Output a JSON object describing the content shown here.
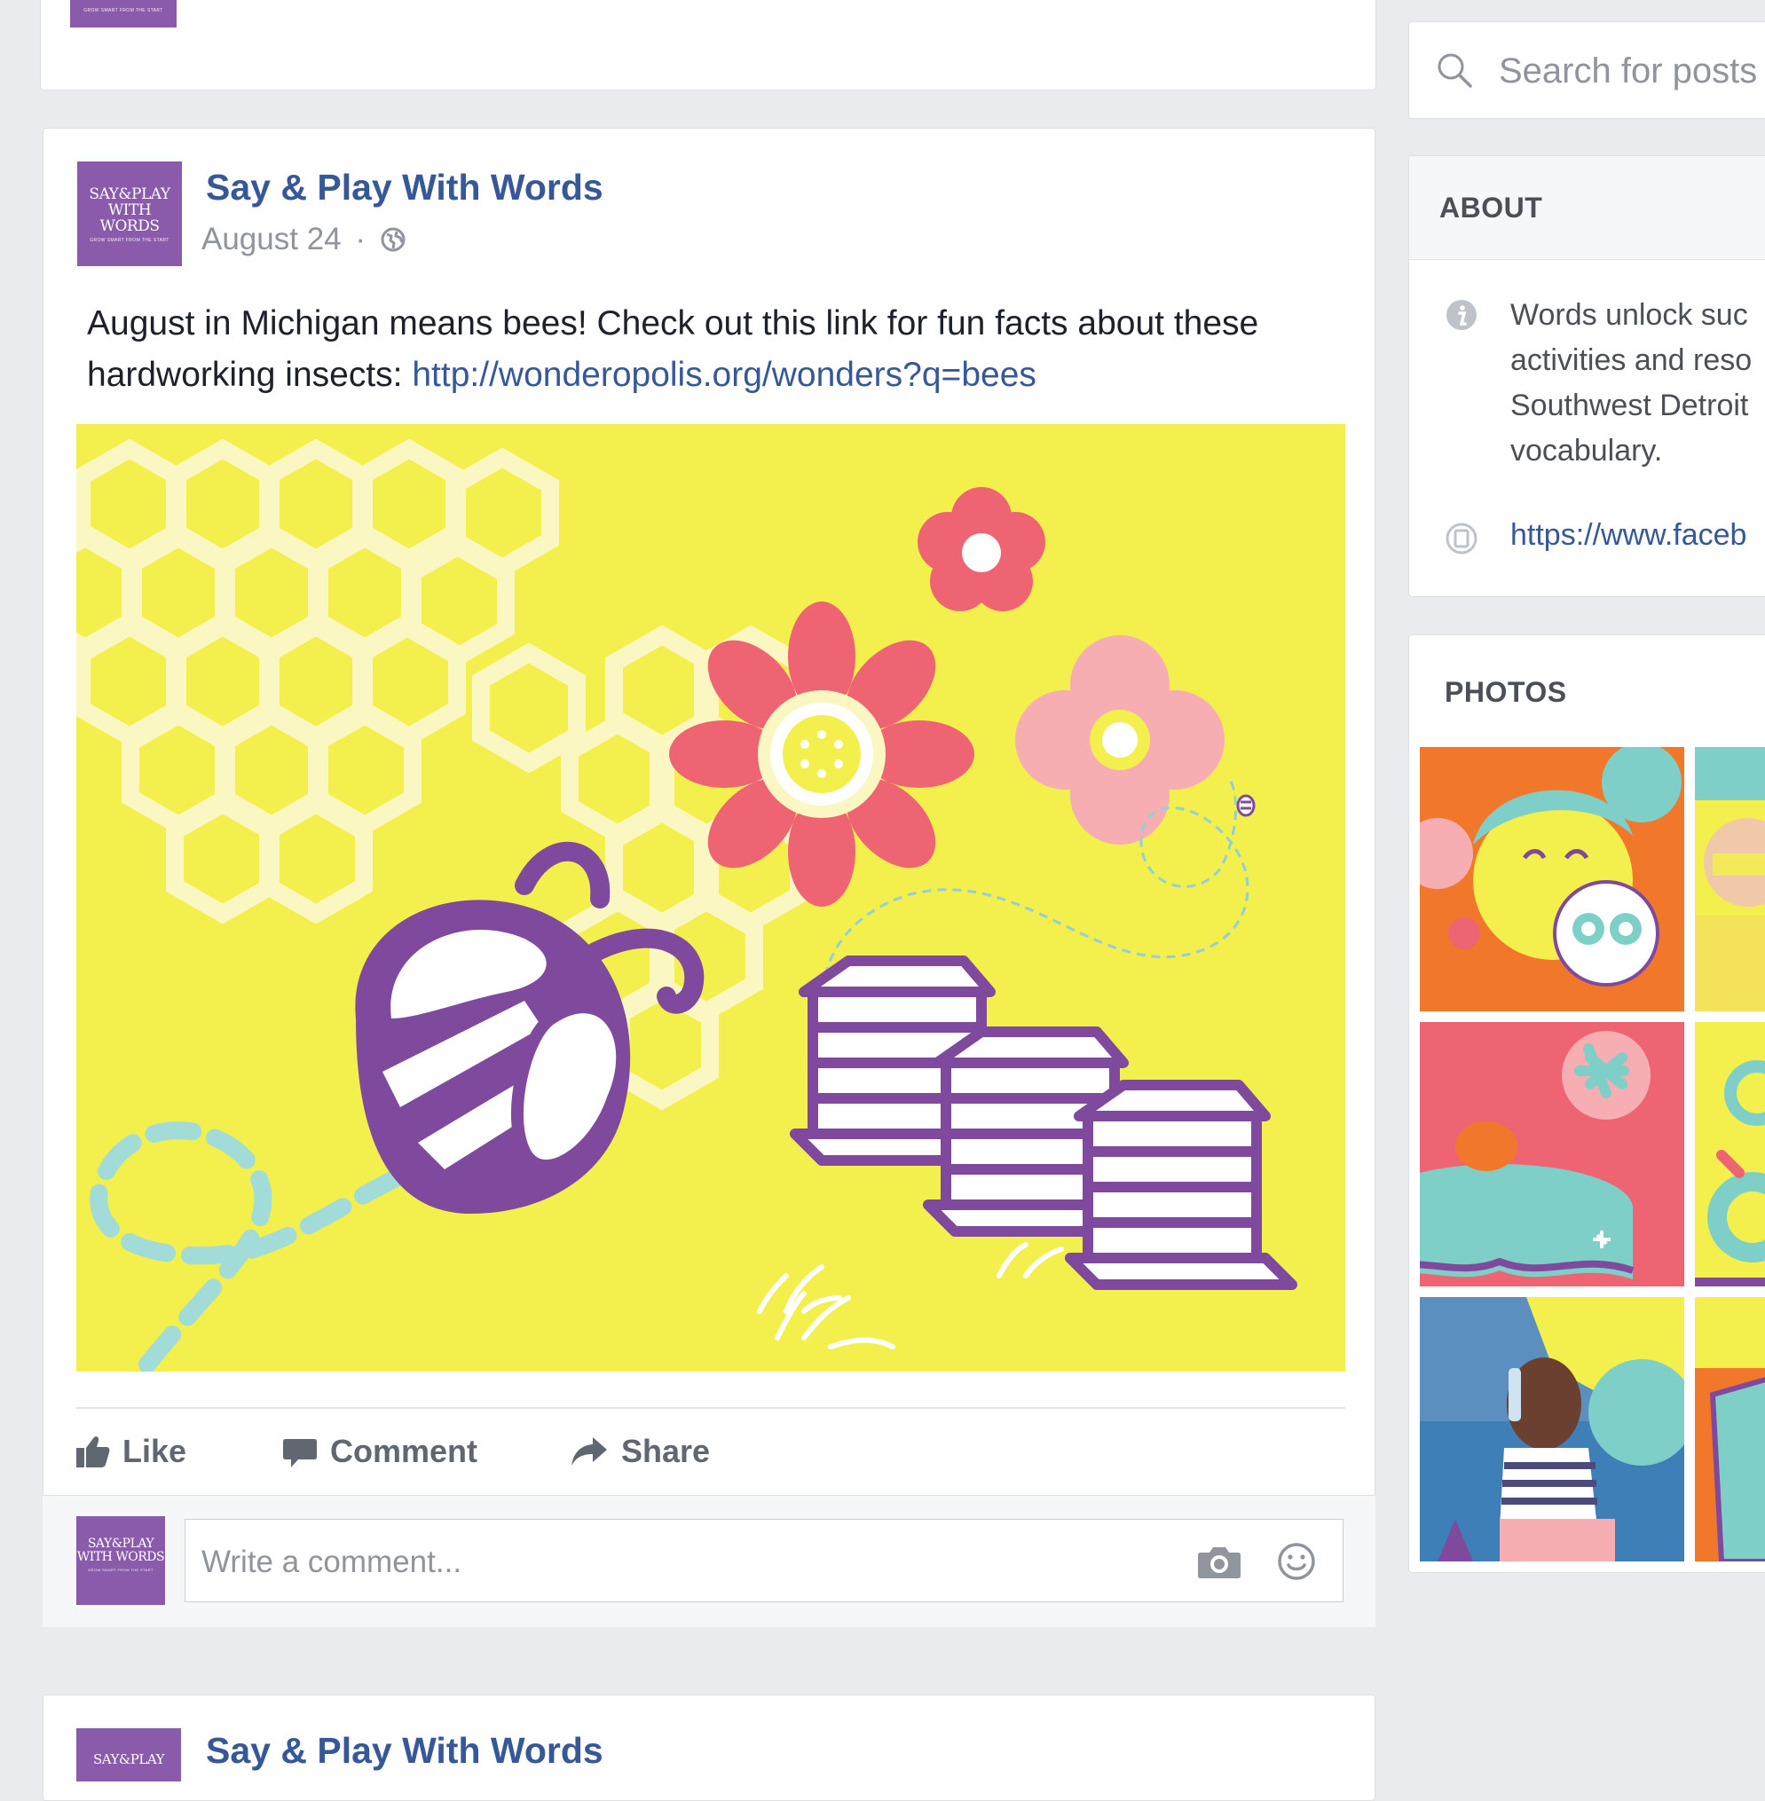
{
  "top_card": {},
  "post": {
    "page_name": "Say & Play With Words",
    "date": "August 24",
    "date_separator": "·",
    "text_before_link": "August in Michigan means bees! Check out this link for fun facts about these hardworking insects: ",
    "link_text": "http://wonderopolis.org/wonders?q=bees",
    "image_alt": "Bee illustration with honeycomb, flowers and beehives",
    "actions": {
      "like": "Like",
      "comment": "Comment",
      "share": "Share"
    },
    "comment_placeholder": "Write a comment..."
  },
  "logo": {
    "line1": "SAY&PLAY",
    "line2": "WITH WORDS",
    "tagline": "GROW SMART FROM THE START"
  },
  "next_post": {
    "page_name": "Say & Play With Words"
  },
  "sidebar": {
    "search_placeholder": "Search for posts",
    "about": {
      "title": "ABOUT",
      "description_lines": [
        "Words unlock suc",
        "activities and reso",
        "Southwest Detroit",
        "vocabulary."
      ],
      "link": "https://www.faceb"
    },
    "photos": {
      "title": "PHOTOS"
    }
  },
  "colors": {
    "brand_purple": "#8a5aab",
    "link_blue": "#365899",
    "bee_purple": "#7f4a9e",
    "image_yellow": "#f3ef4d",
    "flower_red": "#ef6472",
    "flower_pink": "#f6aeb3",
    "dash_teal": "#a2dcd8"
  }
}
